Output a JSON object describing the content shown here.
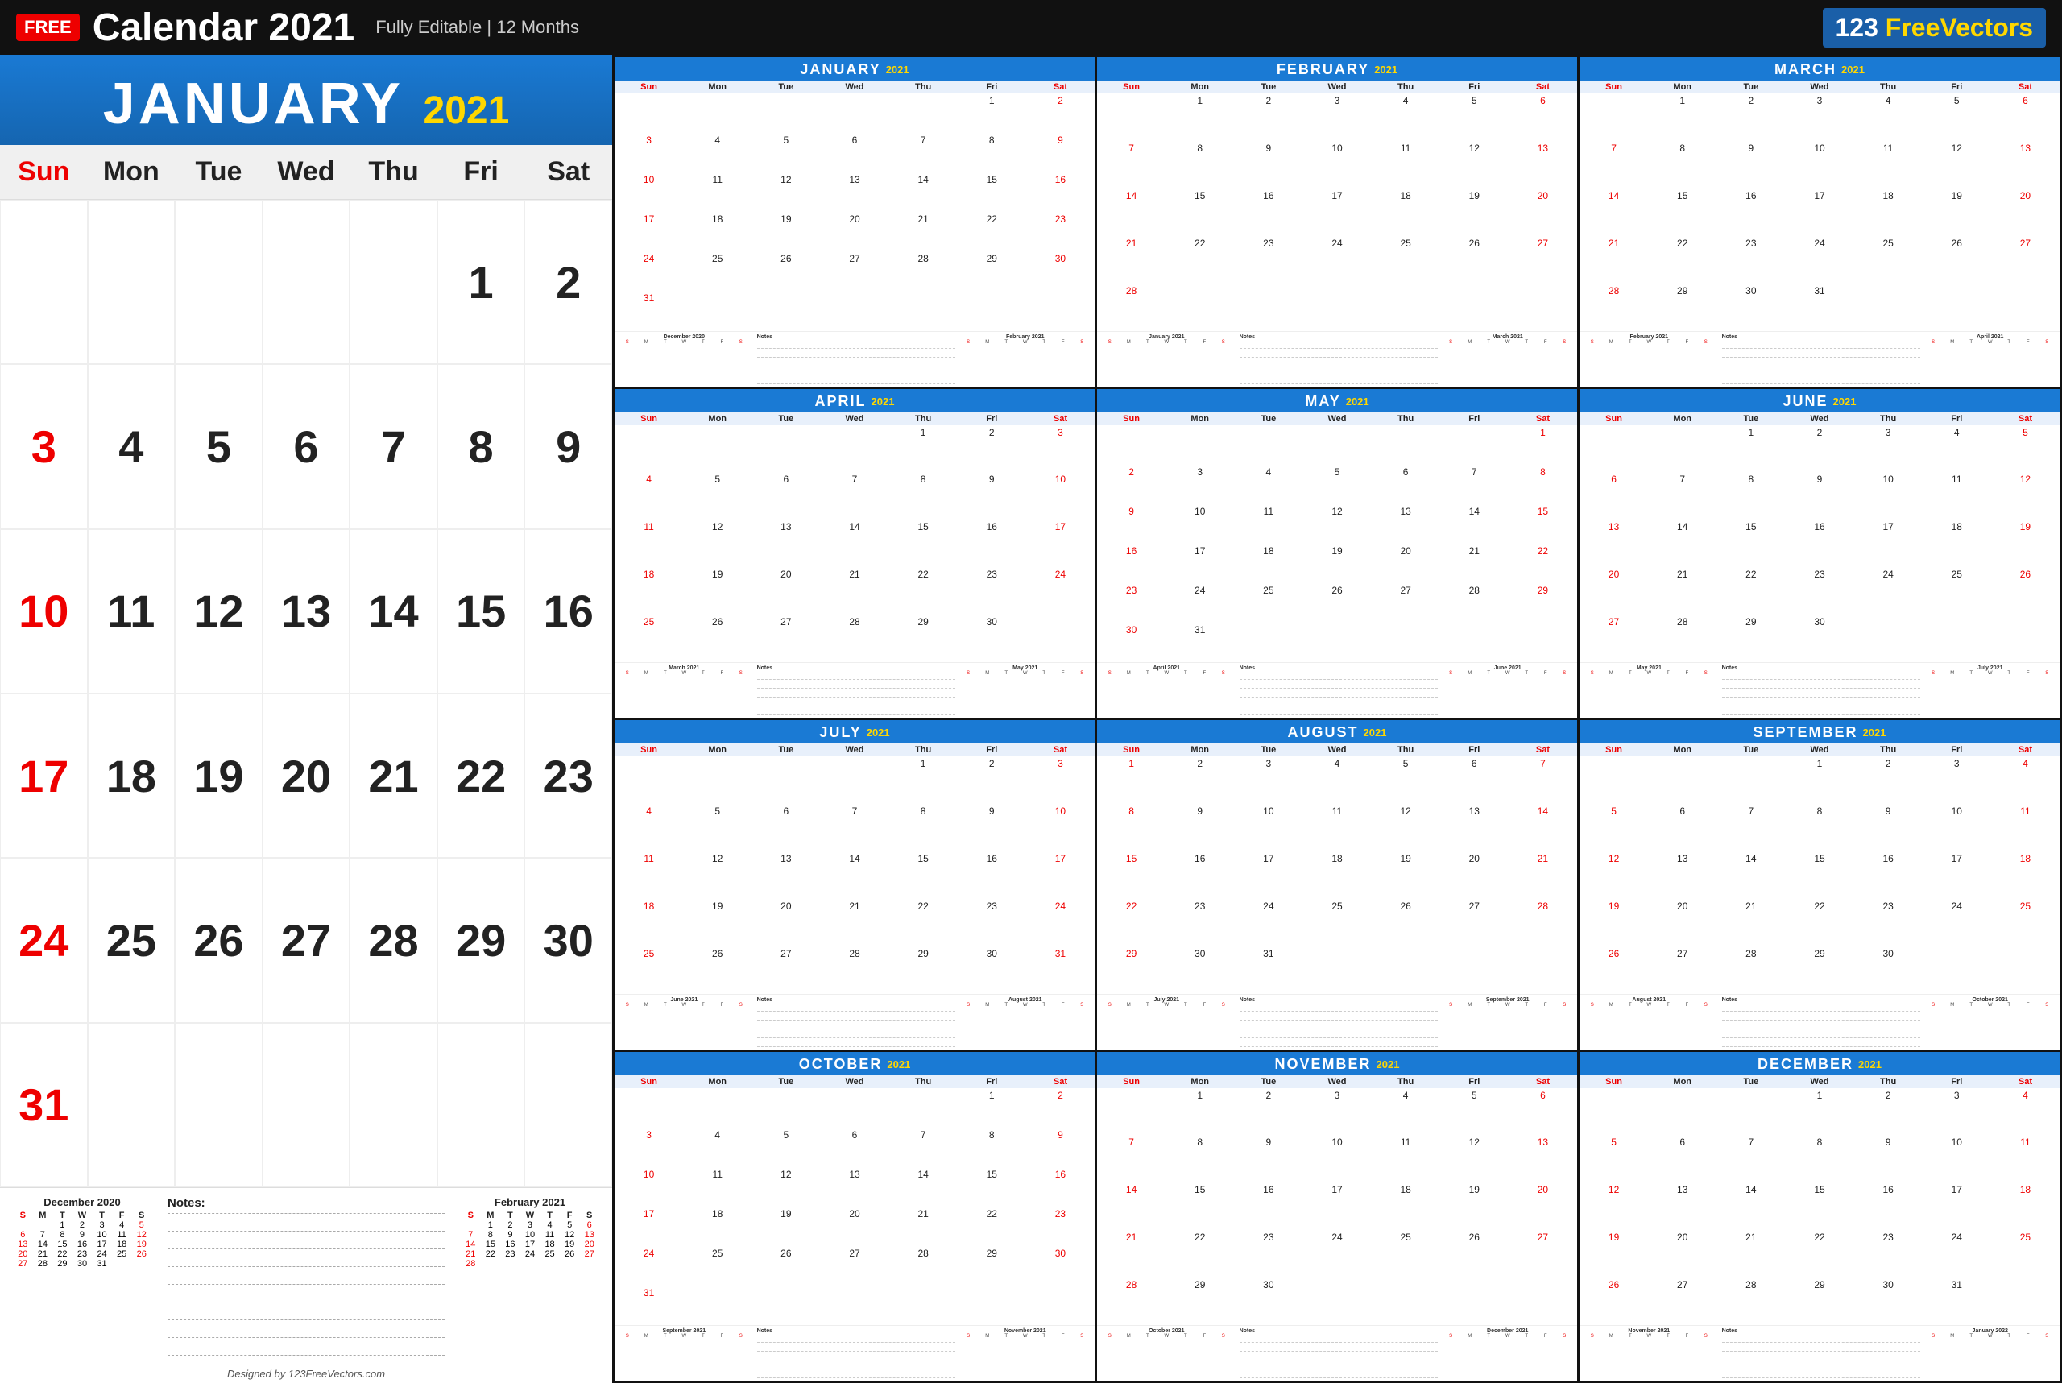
{
  "header": {
    "free_badge": "FREE",
    "title": "Calendar 2021",
    "subtitle": "Fully Editable | 12 Months",
    "logo": "123 FreeVectors"
  },
  "january": {
    "month_name": "JANUARY",
    "year": "2021",
    "day_names": [
      "Sun",
      "Mon",
      "Tue",
      "Wed",
      "Thu",
      "Fri",
      "Sat"
    ],
    "weeks": [
      [
        "",
        "",
        "",
        "",
        "",
        "1",
        "2"
      ],
      [
        "3",
        "4",
        "5",
        "6",
        "7",
        "8",
        "9"
      ],
      [
        "10",
        "11",
        "12",
        "13",
        "14",
        "15",
        "16"
      ],
      [
        "17",
        "18",
        "19",
        "20",
        "21",
        "22",
        "23"
      ],
      [
        "24",
        "25",
        "26",
        "27",
        "28",
        "29",
        "30"
      ],
      [
        "31",
        "",
        "",
        "",
        "",
        "",
        ""
      ]
    ]
  },
  "notes_label": "Notes:",
  "designed_by": "Designed by 123FreeVectors.com",
  "dec2020": {
    "title": "December 2020",
    "headers": [
      "S",
      "M",
      "T",
      "W",
      "T",
      "F",
      "S"
    ],
    "weeks": [
      [
        "",
        "",
        "1",
        "2",
        "3",
        "4",
        "5"
      ],
      [
        "6",
        "7",
        "8",
        "9",
        "10",
        "11",
        "12"
      ],
      [
        "13",
        "14",
        "15",
        "16",
        "17",
        "18",
        "19"
      ],
      [
        "20",
        "21",
        "22",
        "23",
        "24",
        "25",
        "26"
      ],
      [
        "27",
        "28",
        "29",
        "30",
        "31",
        "",
        ""
      ]
    ]
  },
  "feb2021": {
    "title": "February 2021",
    "headers": [
      "S",
      "M",
      "T",
      "W",
      "T",
      "F",
      "S"
    ],
    "weeks": [
      [
        "",
        "1",
        "2",
        "3",
        "4",
        "5",
        "6"
      ],
      [
        "7",
        "8",
        "9",
        "10",
        "11",
        "12",
        "13"
      ],
      [
        "14",
        "15",
        "16",
        "17",
        "18",
        "19",
        "20"
      ],
      [
        "21",
        "22",
        "23",
        "24",
        "25",
        "26",
        "27"
      ],
      [
        "28",
        "",
        "",
        "",
        "",
        "",
        ""
      ]
    ]
  },
  "months": [
    {
      "name": "JANUARY",
      "year": "2021",
      "weeks": [
        [
          "",
          "",
          "",
          "",
          "",
          "1",
          "2"
        ],
        [
          "3",
          "4",
          "5",
          "6",
          "7",
          "8",
          "9"
        ],
        [
          "10",
          "11",
          "12",
          "13",
          "14",
          "15",
          "16"
        ],
        [
          "17",
          "18",
          "19",
          "20",
          "21",
          "22",
          "23"
        ],
        [
          "24",
          "25",
          "26",
          "27",
          "28",
          "29",
          "30"
        ],
        [
          "31",
          "",
          "",
          "",
          "",
          "",
          ""
        ]
      ],
      "prev_title": "December 2020",
      "next_title": "February 2021"
    },
    {
      "name": "FEBRUARY",
      "year": "2021",
      "weeks": [
        [
          "",
          "1",
          "2",
          "3",
          "4",
          "5",
          "6"
        ],
        [
          "7",
          "8",
          "9",
          "10",
          "11",
          "12",
          "13"
        ],
        [
          "14",
          "15",
          "16",
          "17",
          "18",
          "19",
          "20"
        ],
        [
          "21",
          "22",
          "23",
          "24",
          "25",
          "26",
          "27"
        ],
        [
          "28",
          "",
          "",
          "",
          "",
          "",
          ""
        ]
      ],
      "prev_title": "January 2021",
      "next_title": "March 2021"
    },
    {
      "name": "MARCH",
      "year": "2021",
      "weeks": [
        [
          "",
          "1",
          "2",
          "3",
          "4",
          "5",
          "6"
        ],
        [
          "7",
          "8",
          "9",
          "10",
          "11",
          "12",
          "13"
        ],
        [
          "14",
          "15",
          "16",
          "17",
          "18",
          "19",
          "20"
        ],
        [
          "21",
          "22",
          "23",
          "24",
          "25",
          "26",
          "27"
        ],
        [
          "28",
          "29",
          "30",
          "31",
          "",
          "",
          ""
        ]
      ],
      "prev_title": "February 2021",
      "next_title": "April 2021"
    },
    {
      "name": "APRIL",
      "year": "2021",
      "weeks": [
        [
          "",
          "",
          "",
          "",
          "1",
          "2",
          "3"
        ],
        [
          "4",
          "5",
          "6",
          "7",
          "8",
          "9",
          "10"
        ],
        [
          "11",
          "12",
          "13",
          "14",
          "15",
          "16",
          "17"
        ],
        [
          "18",
          "19",
          "20",
          "21",
          "22",
          "23",
          "24"
        ],
        [
          "25",
          "26",
          "27",
          "28",
          "29",
          "30",
          ""
        ]
      ],
      "prev_title": "March 2021",
      "next_title": "May 2021"
    },
    {
      "name": "MAY",
      "year": "2021",
      "weeks": [
        [
          "",
          "",
          "",
          "",
          "",
          "",
          "1"
        ],
        [
          "2",
          "3",
          "4",
          "5",
          "6",
          "7",
          "8"
        ],
        [
          "9",
          "10",
          "11",
          "12",
          "13",
          "14",
          "15"
        ],
        [
          "16",
          "17",
          "18",
          "19",
          "20",
          "21",
          "22"
        ],
        [
          "23",
          "24",
          "25",
          "26",
          "27",
          "28",
          "29"
        ],
        [
          "30",
          "31",
          "",
          "",
          "",
          "",
          ""
        ]
      ],
      "prev_title": "April 2021",
      "next_title": "June 2021"
    },
    {
      "name": "JUNE",
      "year": "2021",
      "weeks": [
        [
          "",
          "",
          "1",
          "2",
          "3",
          "4",
          "5"
        ],
        [
          "6",
          "7",
          "8",
          "9",
          "10",
          "11",
          "12"
        ],
        [
          "13",
          "14",
          "15",
          "16",
          "17",
          "18",
          "19"
        ],
        [
          "20",
          "21",
          "22",
          "23",
          "24",
          "25",
          "26"
        ],
        [
          "27",
          "28",
          "29",
          "30",
          "",
          "",
          ""
        ]
      ],
      "prev_title": "May 2021",
      "next_title": "July 2021"
    },
    {
      "name": "JULY",
      "year": "2021",
      "weeks": [
        [
          "",
          "",
          "",
          "",
          "1",
          "2",
          "3"
        ],
        [
          "4",
          "5",
          "6",
          "7",
          "8",
          "9",
          "10"
        ],
        [
          "11",
          "12",
          "13",
          "14",
          "15",
          "16",
          "17"
        ],
        [
          "18",
          "19",
          "20",
          "21",
          "22",
          "23",
          "24"
        ],
        [
          "25",
          "26",
          "27",
          "28",
          "29",
          "30",
          "31"
        ]
      ],
      "prev_title": "June 2021",
      "next_title": "August 2021"
    },
    {
      "name": "AUGUST",
      "year": "2021",
      "weeks": [
        [
          "1",
          "2",
          "3",
          "4",
          "5",
          "6",
          "7"
        ],
        [
          "8",
          "9",
          "10",
          "11",
          "12",
          "13",
          "14"
        ],
        [
          "15",
          "16",
          "17",
          "18",
          "19",
          "20",
          "21"
        ],
        [
          "22",
          "23",
          "24",
          "25",
          "26",
          "27",
          "28"
        ],
        [
          "29",
          "30",
          "31",
          "",
          "",
          "",
          ""
        ]
      ],
      "prev_title": "July 2021",
      "next_title": "September 2021"
    },
    {
      "name": "SEPTEMBER",
      "year": "2021",
      "weeks": [
        [
          "",
          "",
          "",
          "1",
          "2",
          "3",
          "4"
        ],
        [
          "5",
          "6",
          "7",
          "8",
          "9",
          "10",
          "11"
        ],
        [
          "12",
          "13",
          "14",
          "15",
          "16",
          "17",
          "18"
        ],
        [
          "19",
          "20",
          "21",
          "22",
          "23",
          "24",
          "25"
        ],
        [
          "26",
          "27",
          "28",
          "29",
          "30",
          "",
          ""
        ]
      ],
      "prev_title": "August 2021",
      "next_title": "October 2021"
    },
    {
      "name": "OCTOBER",
      "year": "2021",
      "weeks": [
        [
          "",
          "",
          "",
          "",
          "",
          "1",
          "2"
        ],
        [
          "3",
          "4",
          "5",
          "6",
          "7",
          "8",
          "9"
        ],
        [
          "10",
          "11",
          "12",
          "13",
          "14",
          "15",
          "16"
        ],
        [
          "17",
          "18",
          "19",
          "20",
          "21",
          "22",
          "23"
        ],
        [
          "24",
          "25",
          "26",
          "27",
          "28",
          "29",
          "30"
        ],
        [
          "31",
          "",
          "",
          "",
          "",
          "",
          ""
        ]
      ],
      "prev_title": "September 2021",
      "next_title": "November 2021"
    },
    {
      "name": "NOVEMBER",
      "year": "2021",
      "weeks": [
        [
          "",
          "1",
          "2",
          "3",
          "4",
          "5",
          "6"
        ],
        [
          "7",
          "8",
          "9",
          "10",
          "11",
          "12",
          "13"
        ],
        [
          "14",
          "15",
          "16",
          "17",
          "18",
          "19",
          "20"
        ],
        [
          "21",
          "22",
          "23",
          "24",
          "25",
          "26",
          "27"
        ],
        [
          "28",
          "29",
          "30",
          "",
          "",
          "",
          ""
        ]
      ],
      "prev_title": "October 2021",
      "next_title": "December 2021"
    },
    {
      "name": "DECEMBER",
      "year": "2021",
      "weeks": [
        [
          "",
          "",
          "",
          "1",
          "2",
          "3",
          "4"
        ],
        [
          "5",
          "6",
          "7",
          "8",
          "9",
          "10",
          "11"
        ],
        [
          "12",
          "13",
          "14",
          "15",
          "16",
          "17",
          "18"
        ],
        [
          "19",
          "20",
          "21",
          "22",
          "23",
          "24",
          "25"
        ],
        [
          "26",
          "27",
          "28",
          "29",
          "30",
          "31",
          ""
        ]
      ],
      "prev_title": "November 2021",
      "next_title": "January 2022"
    }
  ]
}
